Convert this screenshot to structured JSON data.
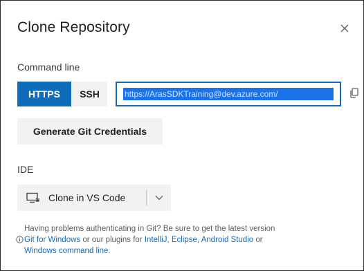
{
  "dialog": {
    "title": "Clone Repository",
    "close_icon": "close-icon"
  },
  "command_line": {
    "label": "Command line",
    "protocols": [
      {
        "label": "HTTPS",
        "selected": true
      },
      {
        "label": "SSH",
        "selected": false
      }
    ],
    "url": "https://ArasSDKTraining@dev.azure.com/",
    "copy_icon": "copy-icon",
    "generate_button": "Generate Git Credentials"
  },
  "ide": {
    "label": "IDE",
    "clone_button": "Clone in VS Code",
    "clone_icon": "vs-code-monitor-icon",
    "dropdown_icon": "chevron-down-icon"
  },
  "help": {
    "line1": "Having problems authenticating in Git? Be sure to get the latest version",
    "link_git_windows": "Git for Windows",
    "text_plugins": " or our plugins for ",
    "link_intellij": "IntelliJ",
    "sep1": ", ",
    "link_eclipse": "Eclipse",
    "sep2": ", ",
    "link_android": "Android Studio",
    "text_or": " or",
    "link_windows_cmd": "Windows command line",
    "end": ".",
    "info_icon": "info-icon"
  },
  "colors": {
    "accent": "#0f6cbd",
    "button_bg": "#f3f2f1",
    "text": "#201f1e"
  }
}
